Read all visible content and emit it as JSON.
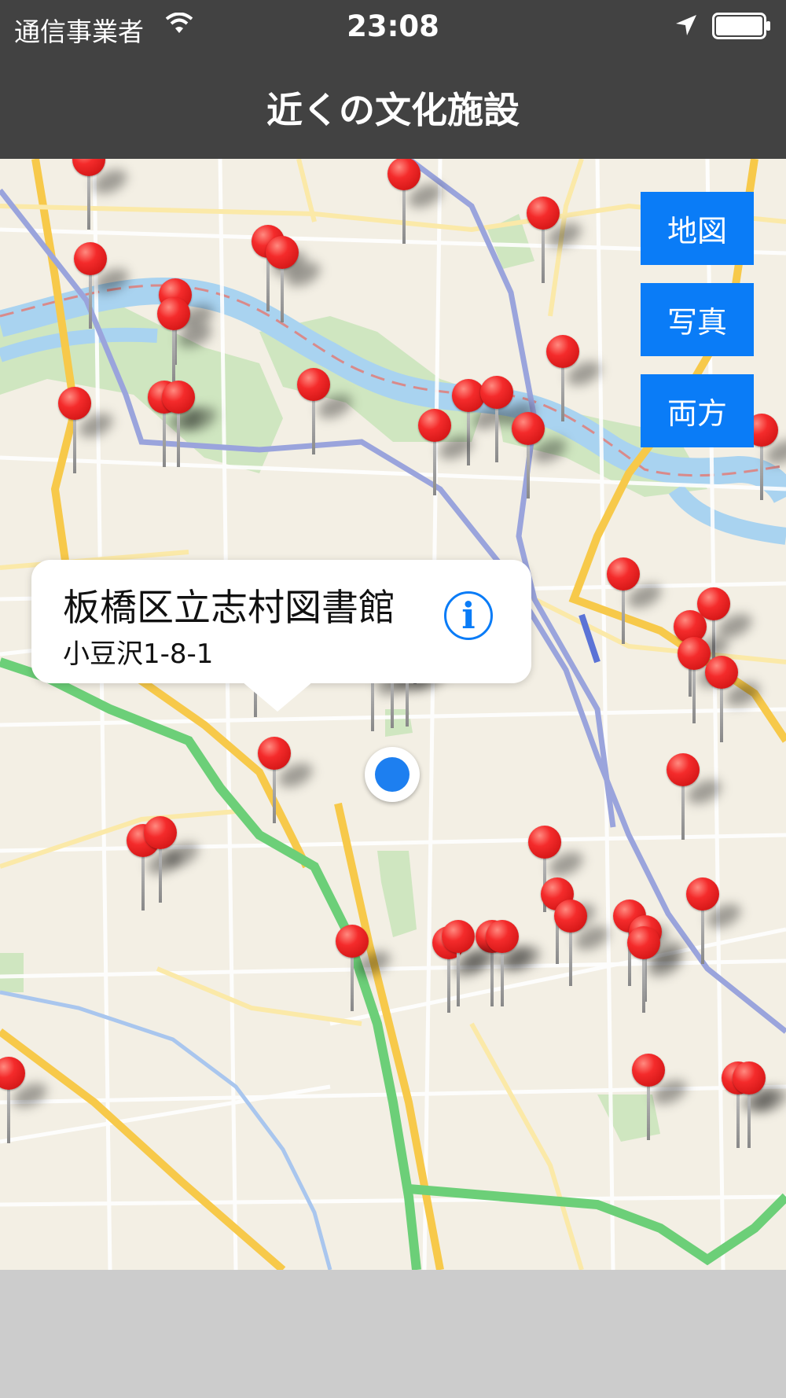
{
  "status_bar": {
    "carrier": "通信事業者",
    "time": "23:08",
    "icons": [
      "wifi-icon",
      "location-arrow-icon",
      "battery-icon"
    ]
  },
  "nav": {
    "title": "近くの文化施設"
  },
  "map_buttons": {
    "map": "地図",
    "photo": "写真",
    "both": "両方"
  },
  "callout": {
    "name": "板橋区立志村図書館",
    "address": "小豆沢1-8-1",
    "info_icon": "i"
  },
  "colors": {
    "accent": "#0a7cf7",
    "pin": "#f42b2b",
    "bar": "#424242",
    "user_location": "#1d7ff0"
  }
}
